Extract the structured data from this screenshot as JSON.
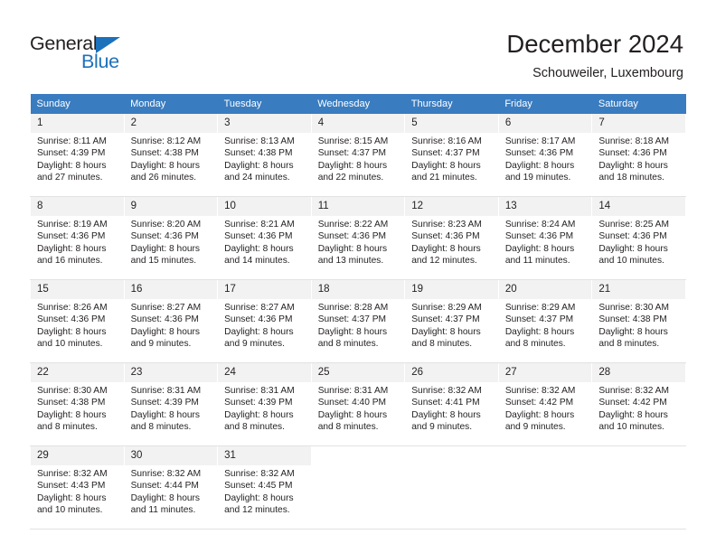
{
  "brand": {
    "name_top": "General",
    "name_bottom": "Blue",
    "triangle_color": "#1c71bb",
    "text_color": "#231f20"
  },
  "header": {
    "title": "December 2024",
    "subtitle": "Schouweiler, Luxembourg"
  },
  "theme": {
    "header_row_bg": "#3a7cc0",
    "header_row_text": "#ffffff",
    "daynum_bg": "#f2f2f2",
    "cell_bg": "#ffffff",
    "grid_line": "#e2e2e2",
    "body_text": "#231f20"
  },
  "weekday_headers": [
    "Sunday",
    "Monday",
    "Tuesday",
    "Wednesday",
    "Thursday",
    "Friday",
    "Saturday"
  ],
  "weeks": [
    [
      {
        "day": "1",
        "sunrise": "Sunrise: 8:11 AM",
        "sunset": "Sunset: 4:39 PM",
        "daylight_1": "Daylight: 8 hours",
        "daylight_2": "and 27 minutes."
      },
      {
        "day": "2",
        "sunrise": "Sunrise: 8:12 AM",
        "sunset": "Sunset: 4:38 PM",
        "daylight_1": "Daylight: 8 hours",
        "daylight_2": "and 26 minutes."
      },
      {
        "day": "3",
        "sunrise": "Sunrise: 8:13 AM",
        "sunset": "Sunset: 4:38 PM",
        "daylight_1": "Daylight: 8 hours",
        "daylight_2": "and 24 minutes."
      },
      {
        "day": "4",
        "sunrise": "Sunrise: 8:15 AM",
        "sunset": "Sunset: 4:37 PM",
        "daylight_1": "Daylight: 8 hours",
        "daylight_2": "and 22 minutes."
      },
      {
        "day": "5",
        "sunrise": "Sunrise: 8:16 AM",
        "sunset": "Sunset: 4:37 PM",
        "daylight_1": "Daylight: 8 hours",
        "daylight_2": "and 21 minutes."
      },
      {
        "day": "6",
        "sunrise": "Sunrise: 8:17 AM",
        "sunset": "Sunset: 4:36 PM",
        "daylight_1": "Daylight: 8 hours",
        "daylight_2": "and 19 minutes."
      },
      {
        "day": "7",
        "sunrise": "Sunrise: 8:18 AM",
        "sunset": "Sunset: 4:36 PM",
        "daylight_1": "Daylight: 8 hours",
        "daylight_2": "and 18 minutes."
      }
    ],
    [
      {
        "day": "8",
        "sunrise": "Sunrise: 8:19 AM",
        "sunset": "Sunset: 4:36 PM",
        "daylight_1": "Daylight: 8 hours",
        "daylight_2": "and 16 minutes."
      },
      {
        "day": "9",
        "sunrise": "Sunrise: 8:20 AM",
        "sunset": "Sunset: 4:36 PM",
        "daylight_1": "Daylight: 8 hours",
        "daylight_2": "and 15 minutes."
      },
      {
        "day": "10",
        "sunrise": "Sunrise: 8:21 AM",
        "sunset": "Sunset: 4:36 PM",
        "daylight_1": "Daylight: 8 hours",
        "daylight_2": "and 14 minutes."
      },
      {
        "day": "11",
        "sunrise": "Sunrise: 8:22 AM",
        "sunset": "Sunset: 4:36 PM",
        "daylight_1": "Daylight: 8 hours",
        "daylight_2": "and 13 minutes."
      },
      {
        "day": "12",
        "sunrise": "Sunrise: 8:23 AM",
        "sunset": "Sunset: 4:36 PM",
        "daylight_1": "Daylight: 8 hours",
        "daylight_2": "and 12 minutes."
      },
      {
        "day": "13",
        "sunrise": "Sunrise: 8:24 AM",
        "sunset": "Sunset: 4:36 PM",
        "daylight_1": "Daylight: 8 hours",
        "daylight_2": "and 11 minutes."
      },
      {
        "day": "14",
        "sunrise": "Sunrise: 8:25 AM",
        "sunset": "Sunset: 4:36 PM",
        "daylight_1": "Daylight: 8 hours",
        "daylight_2": "and 10 minutes."
      }
    ],
    [
      {
        "day": "15",
        "sunrise": "Sunrise: 8:26 AM",
        "sunset": "Sunset: 4:36 PM",
        "daylight_1": "Daylight: 8 hours",
        "daylight_2": "and 10 minutes."
      },
      {
        "day": "16",
        "sunrise": "Sunrise: 8:27 AM",
        "sunset": "Sunset: 4:36 PM",
        "daylight_1": "Daylight: 8 hours",
        "daylight_2": "and 9 minutes."
      },
      {
        "day": "17",
        "sunrise": "Sunrise: 8:27 AM",
        "sunset": "Sunset: 4:36 PM",
        "daylight_1": "Daylight: 8 hours",
        "daylight_2": "and 9 minutes."
      },
      {
        "day": "18",
        "sunrise": "Sunrise: 8:28 AM",
        "sunset": "Sunset: 4:37 PM",
        "daylight_1": "Daylight: 8 hours",
        "daylight_2": "and 8 minutes."
      },
      {
        "day": "19",
        "sunrise": "Sunrise: 8:29 AM",
        "sunset": "Sunset: 4:37 PM",
        "daylight_1": "Daylight: 8 hours",
        "daylight_2": "and 8 minutes."
      },
      {
        "day": "20",
        "sunrise": "Sunrise: 8:29 AM",
        "sunset": "Sunset: 4:37 PM",
        "daylight_1": "Daylight: 8 hours",
        "daylight_2": "and 8 minutes."
      },
      {
        "day": "21",
        "sunrise": "Sunrise: 8:30 AM",
        "sunset": "Sunset: 4:38 PM",
        "daylight_1": "Daylight: 8 hours",
        "daylight_2": "and 8 minutes."
      }
    ],
    [
      {
        "day": "22",
        "sunrise": "Sunrise: 8:30 AM",
        "sunset": "Sunset: 4:38 PM",
        "daylight_1": "Daylight: 8 hours",
        "daylight_2": "and 8 minutes."
      },
      {
        "day": "23",
        "sunrise": "Sunrise: 8:31 AM",
        "sunset": "Sunset: 4:39 PM",
        "daylight_1": "Daylight: 8 hours",
        "daylight_2": "and 8 minutes."
      },
      {
        "day": "24",
        "sunrise": "Sunrise: 8:31 AM",
        "sunset": "Sunset: 4:39 PM",
        "daylight_1": "Daylight: 8 hours",
        "daylight_2": "and 8 minutes."
      },
      {
        "day": "25",
        "sunrise": "Sunrise: 8:31 AM",
        "sunset": "Sunset: 4:40 PM",
        "daylight_1": "Daylight: 8 hours",
        "daylight_2": "and 8 minutes."
      },
      {
        "day": "26",
        "sunrise": "Sunrise: 8:32 AM",
        "sunset": "Sunset: 4:41 PM",
        "daylight_1": "Daylight: 8 hours",
        "daylight_2": "and 9 minutes."
      },
      {
        "day": "27",
        "sunrise": "Sunrise: 8:32 AM",
        "sunset": "Sunset: 4:42 PM",
        "daylight_1": "Daylight: 8 hours",
        "daylight_2": "and 9 minutes."
      },
      {
        "day": "28",
        "sunrise": "Sunrise: 8:32 AM",
        "sunset": "Sunset: 4:42 PM",
        "daylight_1": "Daylight: 8 hours",
        "daylight_2": "and 10 minutes."
      }
    ],
    [
      {
        "day": "29",
        "sunrise": "Sunrise: 8:32 AM",
        "sunset": "Sunset: 4:43 PM",
        "daylight_1": "Daylight: 8 hours",
        "daylight_2": "and 10 minutes."
      },
      {
        "day": "30",
        "sunrise": "Sunrise: 8:32 AM",
        "sunset": "Sunset: 4:44 PM",
        "daylight_1": "Daylight: 8 hours",
        "daylight_2": "and 11 minutes."
      },
      {
        "day": "31",
        "sunrise": "Sunrise: 8:32 AM",
        "sunset": "Sunset: 4:45 PM",
        "daylight_1": "Daylight: 8 hours",
        "daylight_2": "and 12 minutes."
      },
      {
        "day": "",
        "sunrise": "",
        "sunset": "",
        "daylight_1": "",
        "daylight_2": ""
      },
      {
        "day": "",
        "sunrise": "",
        "sunset": "",
        "daylight_1": "",
        "daylight_2": ""
      },
      {
        "day": "",
        "sunrise": "",
        "sunset": "",
        "daylight_1": "",
        "daylight_2": ""
      },
      {
        "day": "",
        "sunrise": "",
        "sunset": "",
        "daylight_1": "",
        "daylight_2": ""
      }
    ]
  ]
}
